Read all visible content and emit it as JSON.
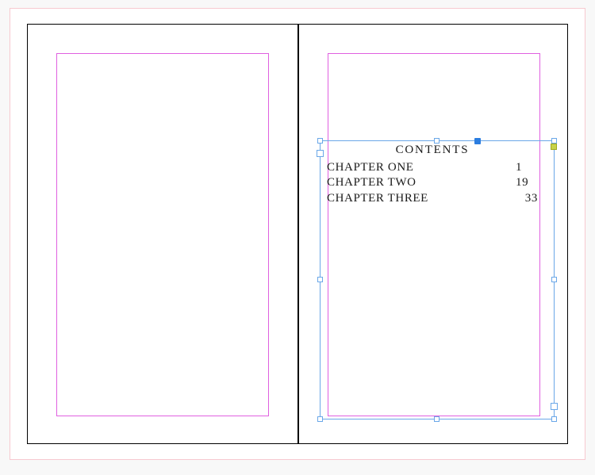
{
  "colors": {
    "bleed": "#f7c9d0",
    "margin": "#e060e0",
    "frame": "#6aa7e8",
    "anchor": "#c7d24a"
  },
  "toc": {
    "title": "CONTENTS",
    "rows": [
      {
        "chapter": "CHAPTER ONE",
        "page": "1"
      },
      {
        "chapter": "CHAPTER TWO",
        "page": "19"
      },
      {
        "chapter": "CHAPTER THREE",
        "page": "33"
      }
    ]
  }
}
